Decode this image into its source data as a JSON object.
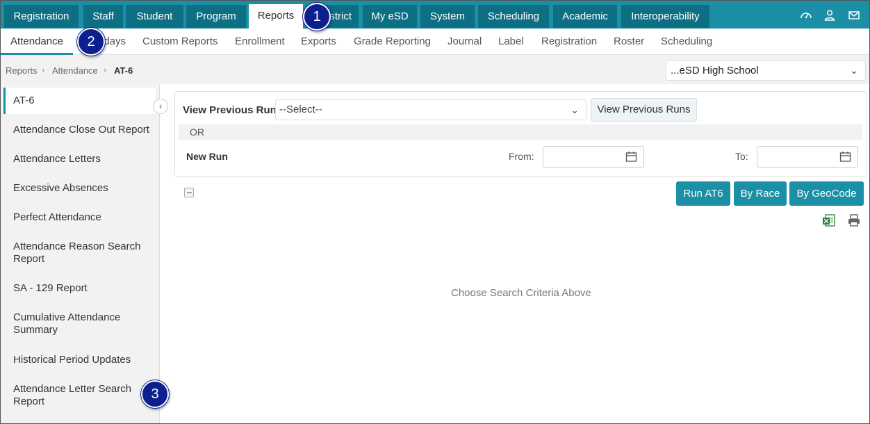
{
  "topnav": {
    "tabs": [
      "Registration",
      "Staff",
      "Student",
      "Program",
      "Reports",
      "District",
      "My eSD",
      "System",
      "Scheduling",
      "Academic",
      "Interoperability"
    ],
    "active": "Reports",
    "icons": [
      "dashboard-icon",
      "user-icon",
      "mail-icon"
    ]
  },
  "subnav": {
    "tabs": [
      "Attendance",
      "Holidays",
      "Custom Reports",
      "Enrollment",
      "Exports",
      "Grade Reporting",
      "Journal",
      "Label",
      "Registration",
      "Roster",
      "Scheduling"
    ],
    "active": "Attendance"
  },
  "breadcrumb": {
    "items": [
      "Reports",
      "Attendance",
      "AT-6"
    ]
  },
  "school_select": {
    "value": "...eSD High School"
  },
  "sidebar": {
    "items": [
      "AT-6",
      "Attendance Close Out Report",
      "Attendance Letters",
      "Excessive Absences",
      "Perfect Attendance",
      "Attendance Reason Search Report",
      "SA - 129 Report",
      "Cumulative Attendance Summary",
      "Historical Period Updates",
      "Attendance Letter Search Report"
    ]
  },
  "form": {
    "view_previous_run_label": "View Previous Run",
    "select_placeholder": "--Select--",
    "view_previous_runs_button": "View Previous Runs",
    "or_label": "OR",
    "new_run_label": "New Run",
    "from_label": "From:",
    "to_label": "To:"
  },
  "actions": {
    "run_at6": "Run AT6",
    "by_race": "By Race",
    "by_geocode": "By GeoCode"
  },
  "empty_message": "Choose Search Criteria Above",
  "callouts": [
    "1",
    "2",
    "3"
  ],
  "colors": {
    "accent": "#1a8fa5",
    "tab_dark": "#0d6f84",
    "callout": "#0b1f8f"
  }
}
